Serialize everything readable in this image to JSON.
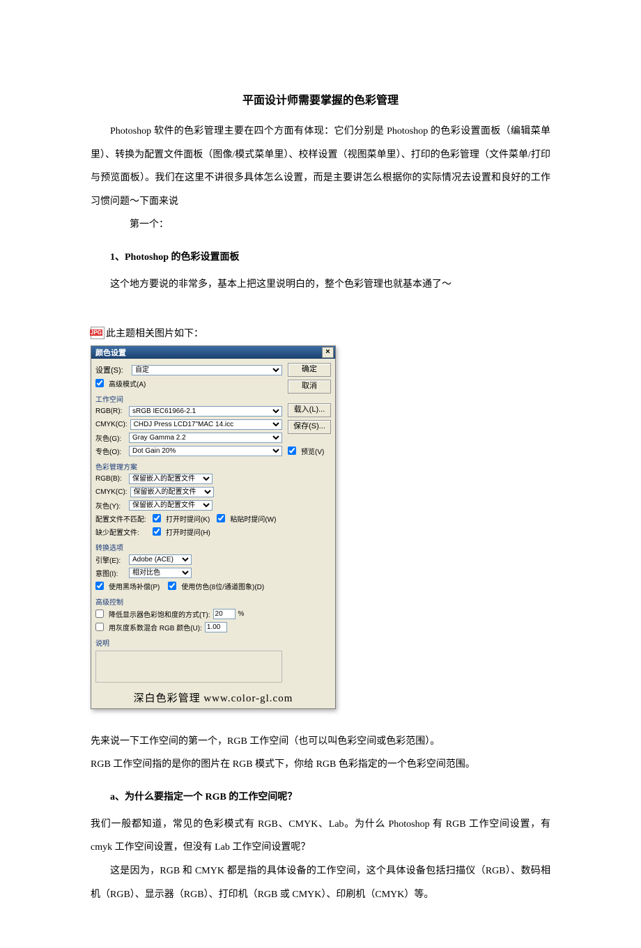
{
  "title": "平面设计师需要掌握的色彩管理",
  "p1": "Photoshop 软件的色彩管理主要在四个方面有体现：它们分别是 Photoshop 的色彩设置面板（编辑菜单里）、转换为配置文件面板（图像/模式菜单里）、校样设置（视图菜单里）、打印的色彩管理（文件菜单/打印与预览面板）。我们在这里不讲很多具体怎么设置，而是主要讲怎么根据你的实际情况去设置和良好的工作习惯问题～下面来说",
  "p2": "第一个：",
  "h1": "1、Photoshop 的色彩设置面板",
  "p3": "这个地方要说的非常多，基本上把这里说明白的，整个色彩管理也就基本通了～",
  "imgcap": "此主题相关图片如下：",
  "dialog": {
    "title": "颜色设置",
    "close": "×",
    "settings_lbl": "设置(S):",
    "settings_val": "自定",
    "advanced": "高级模式(A)",
    "ws_header": "工作空间",
    "rgb_lbl": "RGB(R):",
    "rgb_val": "sRGB IEC61966-2.1",
    "cmyk_lbl": "CMYK(C):",
    "cmyk_val": "CHDJ Press LCD17\"MAC 14.icc",
    "gray_lbl": "灰色(G):",
    "gray_val": "Gray Gamma 2.2",
    "spot_lbl": "专色(O):",
    "spot_val": "Dot Gain 20%",
    "pol_header": "色彩管理方案",
    "p_rgb_lbl": "RGB(B):",
    "p_rgb_val": "保留嵌入的配置文件",
    "p_cmyk_lbl": "CMYK(C):",
    "p_cmyk_val": "保留嵌入的配置文件",
    "p_gray_lbl": "灰色(Y):",
    "p_gray_val": "保留嵌入的配置文件",
    "mismatch_lbl": "配置文件不匹配:",
    "mismatch_open": "打开时提问(K)",
    "mismatch_paste": "粘贴时提问(W)",
    "missing_lbl": "缺少配置文件:",
    "missing_open": "打开时提问(H)",
    "conv_header": "转换选项",
    "engine_lbl": "引擎(E):",
    "engine_val": "Adobe (ACE)",
    "intent_lbl": "意图(I):",
    "intent_val": "相对比色",
    "blackpoint": "使用黑场补偿(P)",
    "dither": "使用仿色(8位/通道图象)(D)",
    "adv_header": "高级控制",
    "desat_lbl": "降低显示器色彩饱和度的方式(T):",
    "desat_val": "20",
    "pct": "%",
    "blend_lbl": "用灰度系数混合 RGB 颜色(U):",
    "blend_val": "1.00",
    "desc_header": "说明",
    "btn_ok": "确定",
    "btn_cancel": "取消",
    "btn_load": "载入(L)...",
    "btn_save": "保存(S)...",
    "preview": "预览(V)",
    "watermark": "深白色彩管理 www.color-gl.com"
  },
  "p4": "先来说一下工作空间的第一个，RGB 工作空间（也可以叫色彩空间或色彩范围）。",
  "p5": "RGB 工作空间指的是你的图片在 RGB 模式下，你给 RGB 色彩指定的一个色彩空间范围。",
  "h2": "a、为什么要指定一个 RGB 的工作空间呢？",
  "p6": "我们一般都知道，常见的色彩模式有 RGB、CMYK、Lab。为什么 Photoshop 有 RGB 工作空间设置，有 cmyk 工作空间设置，但没有 Lab 工作空间设置呢？",
  "p7": "这是因为，RGB 和 CMYK 都是指的具体设备的工作空间，这个具体设备包括扫描仪（RGB）、数码相机（RGB）、显示器（RGB）、打印机（RGB 或 CMYK）、印刷机（CMYK）等。"
}
